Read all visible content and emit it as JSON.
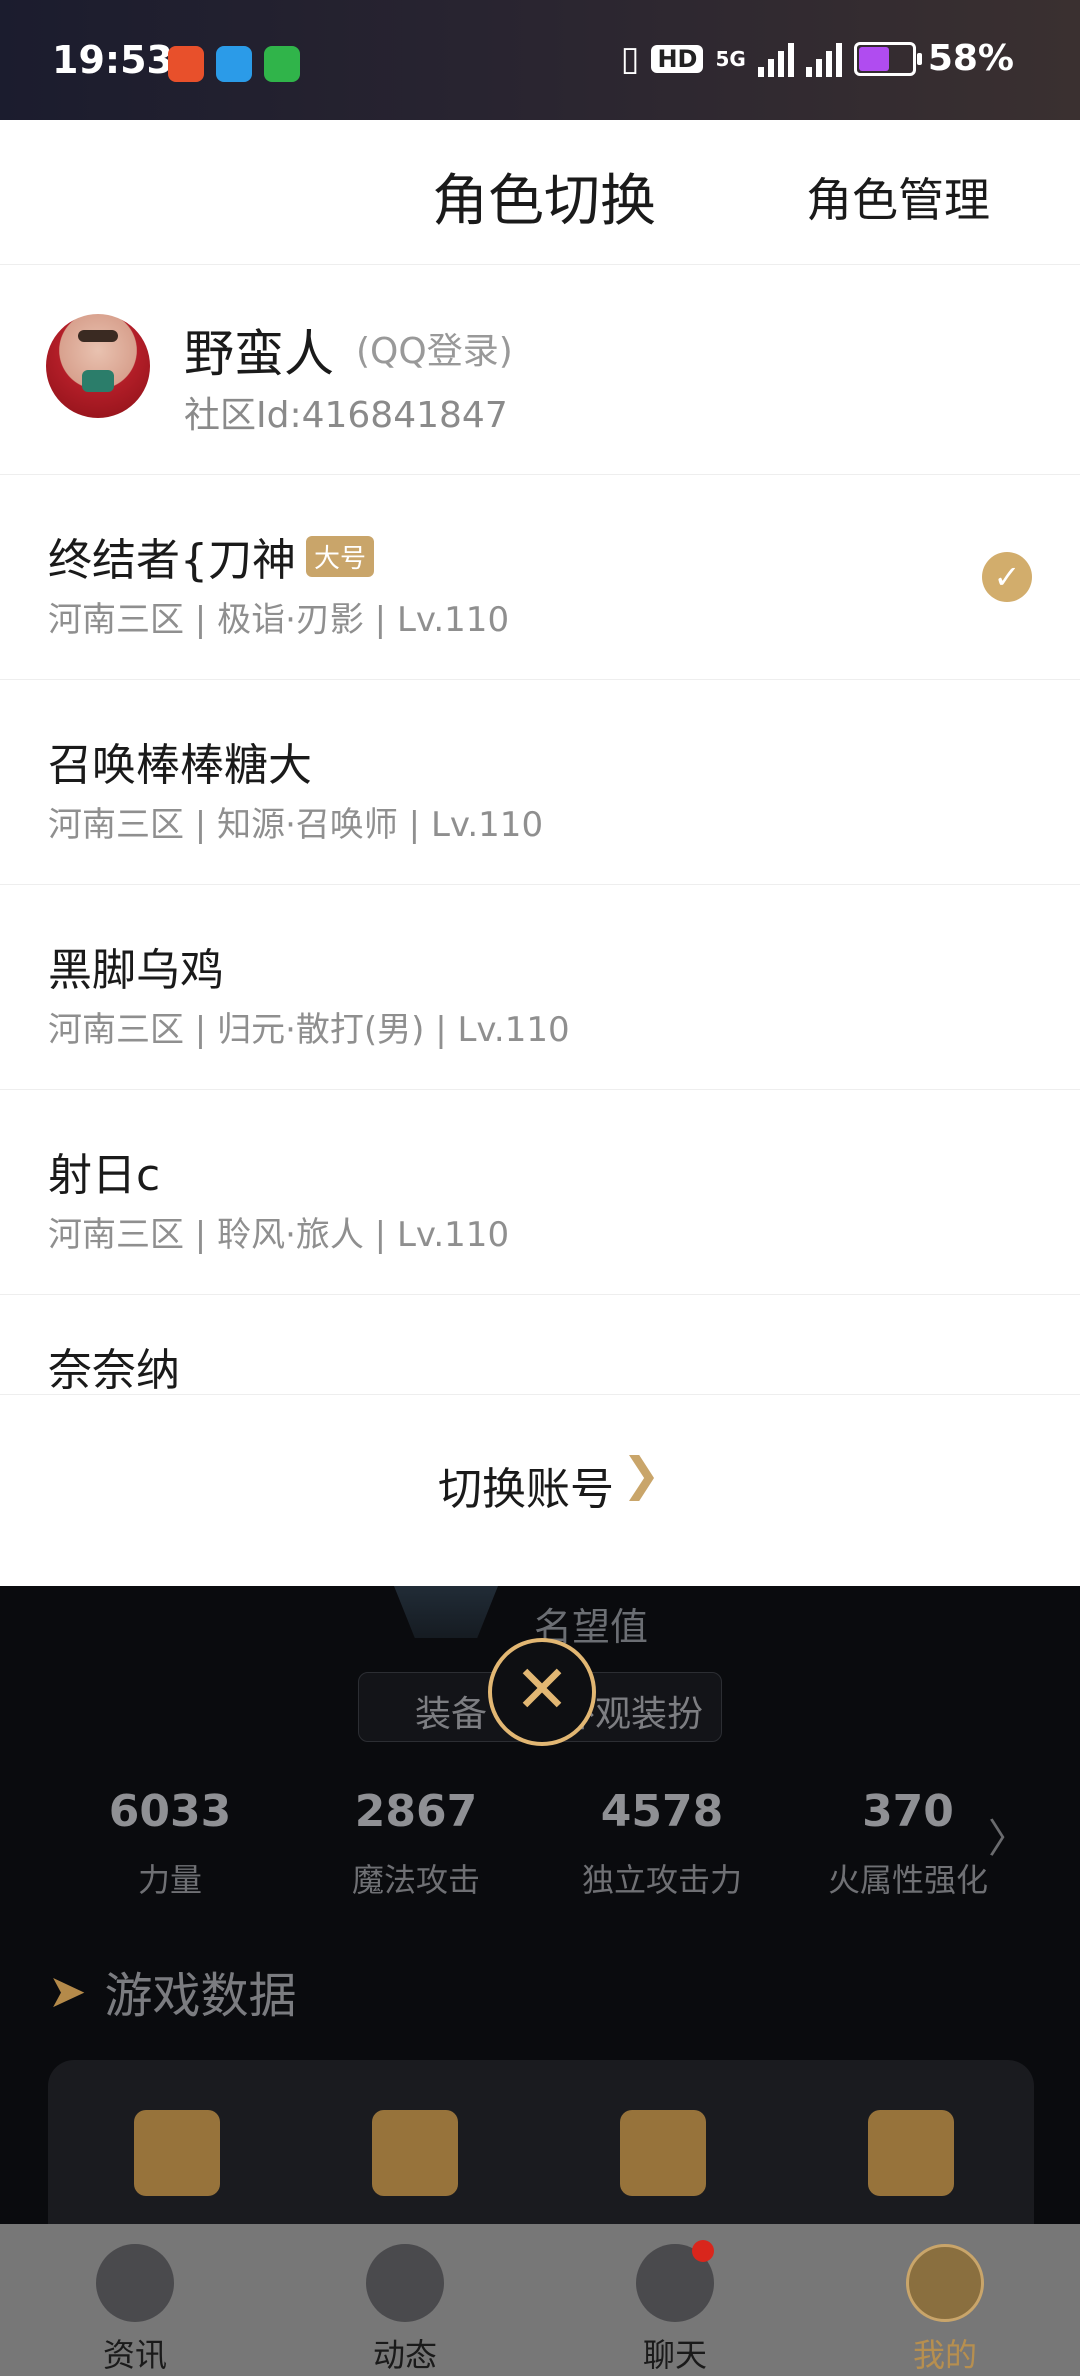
{
  "status_bar": {
    "time": "19:53",
    "battery": "58%",
    "network": "5G",
    "icons": [
      "notification-app-icon",
      "browser-icon",
      "messages-icon",
      "vibrate-icon",
      "hd-icon",
      "signal-icon",
      "battery-icon"
    ]
  },
  "sheet": {
    "title": "角色切换",
    "manage_label": "角色管理",
    "account": {
      "name": "野蛮人",
      "login": "(QQ登录)",
      "community_id": "社区Id:416841847"
    },
    "roles": [
      {
        "name": "终结者{刀神",
        "badge": "大号",
        "info": "河南三区 | 极诣·刃影 | Lv.110",
        "selected": true
      },
      {
        "name": "召唤棒棒糖大",
        "badge": "",
        "info": "河南三区 | 知源·召唤师 | Lv.110",
        "selected": false
      },
      {
        "name": "黑脚乌鸡",
        "badge": "",
        "info": "河南三区 | 归元·散打(男) | Lv.110",
        "selected": false
      },
      {
        "name": "射日c",
        "badge": "",
        "info": "河南三区 | 聆风·旅人 | Lv.110",
        "selected": false
      },
      {
        "name": "奈奈纳",
        "badge": "",
        "info": "",
        "selected": false
      }
    ],
    "switch_account_label": "切换账号",
    "chevron": "❯"
  },
  "profile": {
    "renown_label": "名望值",
    "tabs": [
      "装备",
      "外观装扮"
    ],
    "stats": [
      {
        "value": "6033",
        "label": "力量"
      },
      {
        "value": "2867",
        "label": "魔法攻击"
      },
      {
        "value": "4578",
        "label": "独立攻击力"
      },
      {
        "value": "370",
        "label": "火属性强化"
      }
    ],
    "section_title": "游戏数据",
    "stats_chevron": "〉"
  },
  "bottom_nav": {
    "items": [
      {
        "label": "资讯",
        "icon": "news-icon"
      },
      {
        "label": "动态",
        "icon": "dragon-icon"
      },
      {
        "label": "聊天",
        "icon": "chat-icon"
      },
      {
        "label": "我的",
        "icon": "profile-icon",
        "active": true
      }
    ]
  },
  "colors": {
    "accent": "#c9a56a",
    "check": "#d2ad6c",
    "close_ring": "#e2b773"
  }
}
